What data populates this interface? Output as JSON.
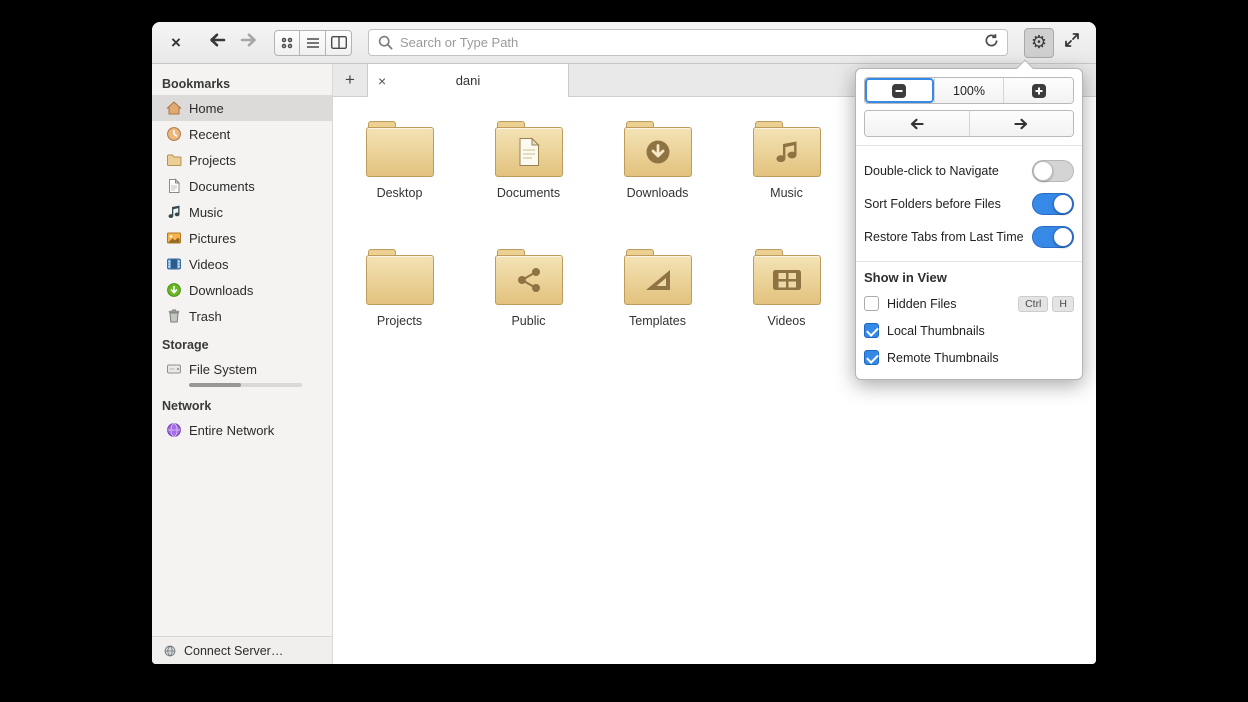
{
  "header": {
    "search_placeholder": "Search or Type Path"
  },
  "icons": {
    "window_close": "×",
    "tab_close": "×",
    "new_tab": "+",
    "gear": "⚙"
  },
  "sidebar": {
    "sections": {
      "bookmarks": "Bookmarks",
      "storage": "Storage",
      "network": "Network"
    },
    "bookmarks": [
      {
        "label": "Home",
        "selected": true
      },
      {
        "label": "Recent"
      },
      {
        "label": "Projects"
      },
      {
        "label": "Documents"
      },
      {
        "label": "Music"
      },
      {
        "label": "Pictures"
      },
      {
        "label": "Videos"
      },
      {
        "label": "Downloads"
      },
      {
        "label": "Trash"
      }
    ],
    "storage_items": [
      {
        "label": "File System"
      }
    ],
    "network_items": [
      {
        "label": "Entire Network"
      }
    ],
    "connect_server": "Connect Server…"
  },
  "tabbar": {
    "active_tab": "dani"
  },
  "files": [
    {
      "name": "Desktop"
    },
    {
      "name": "Documents"
    },
    {
      "name": "Downloads"
    },
    {
      "name": "Music"
    },
    {
      "name": "Projects"
    },
    {
      "name": "Public"
    },
    {
      "name": "Templates"
    },
    {
      "name": "Videos"
    }
  ],
  "popover": {
    "zoom_level": "100%",
    "toggles": [
      {
        "label": "Double-click to Navigate",
        "enabled": false
      },
      {
        "label": "Sort Folders before Files",
        "enabled": true
      },
      {
        "label": "Restore Tabs from Last Time",
        "enabled": true
      }
    ],
    "show_in_view_title": "Show in View",
    "checkboxes": [
      {
        "label": "Hidden Files",
        "checked": false,
        "shortcut": [
          "Ctrl",
          "H"
        ]
      },
      {
        "label": "Local Thumbnails",
        "checked": true
      },
      {
        "label": "Remote Thumbnails",
        "checked": true
      }
    ]
  },
  "colors": {
    "accent": "#3689e6",
    "folder_light": "#f4e3b6",
    "folder_dark": "#e2c27d"
  }
}
